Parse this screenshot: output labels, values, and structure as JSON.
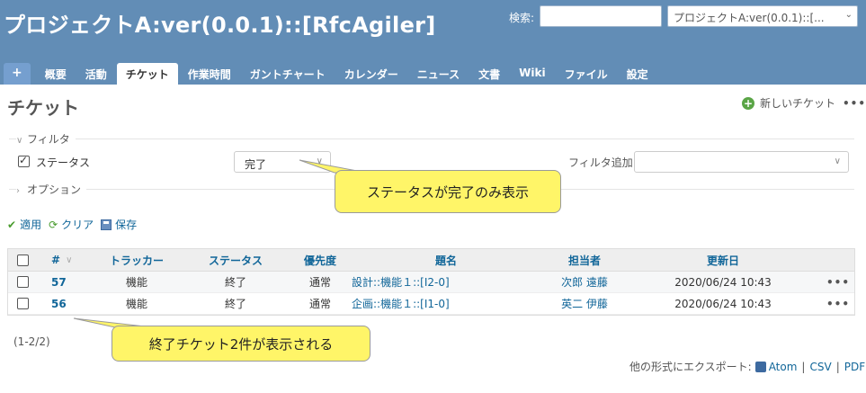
{
  "header": {
    "project_title": "プロジェクトA:ver(0.0.1)::[RfcAgiler]",
    "search_label": "検索:",
    "search_value": "",
    "project_select_value": "プロジェクトA:ver(0.0.1)::[..."
  },
  "tabs": [
    {
      "label": "+"
    },
    {
      "label": "概要"
    },
    {
      "label": "活動"
    },
    {
      "label": "チケット",
      "active": true
    },
    {
      "label": "作業時間"
    },
    {
      "label": "ガントチャート"
    },
    {
      "label": "カレンダー"
    },
    {
      "label": "ニュース"
    },
    {
      "label": "文書"
    },
    {
      "label": "Wiki"
    },
    {
      "label": "ファイル"
    },
    {
      "label": "設定"
    }
  ],
  "page": {
    "title": "チケット",
    "new_ticket_label": "新しいチケット",
    "more_label": "•••"
  },
  "filters": {
    "legend": "フィルタ",
    "status_label": "ステータス",
    "status_checked": true,
    "status_value": "完了",
    "add_filter_label": "フィルタ追加",
    "add_filter_value": ""
  },
  "options": {
    "legend": "オプション"
  },
  "actions": {
    "apply": "適用",
    "clear": "クリア",
    "save": "保存"
  },
  "table": {
    "columns": {
      "num": "#",
      "tracker": "トラッカー",
      "status": "ステータス",
      "priority": "優先度",
      "subject": "題名",
      "assignee": "担当者",
      "updated": "更新日"
    },
    "rows": [
      {
        "id": "57",
        "tracker": "機能",
        "status": "終了",
        "priority": "通常",
        "subject": "設計::機能１::[I2-0]",
        "assignee": "次郎 遠藤",
        "updated": "2020/06/24 10:43",
        "more": "•••"
      },
      {
        "id": "56",
        "tracker": "機能",
        "status": "終了",
        "priority": "通常",
        "subject": "企画::機能１::[I1-0]",
        "assignee": "英二 伊藤",
        "updated": "2020/06/24 10:43",
        "more": "•••"
      }
    ]
  },
  "count_text": "(1-2/2)",
  "export": {
    "label": "他の形式にエクスポート:",
    "atom": "Atom",
    "sep1": "|",
    "csv": "CSV",
    "sep2": "|",
    "pdf": "PDF"
  },
  "callouts": {
    "status_note": "ステータスが完了のみ表示",
    "count_note": "終了チケット2件が表示される"
  },
  "colors": {
    "header_bg": "#628db6",
    "link": "#116699",
    "callout_bg": "#fff568"
  }
}
